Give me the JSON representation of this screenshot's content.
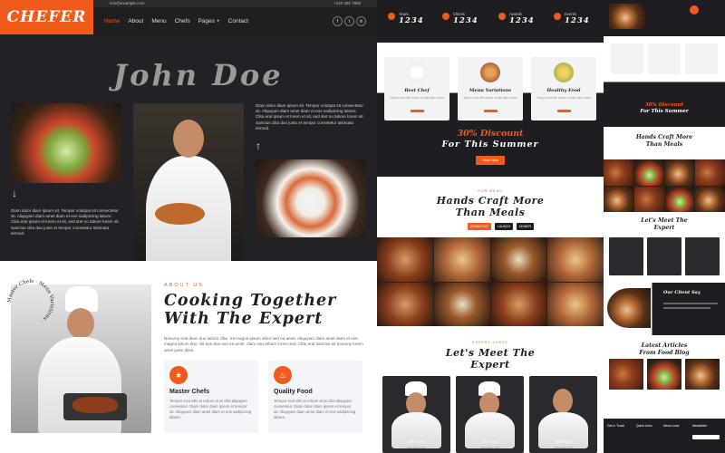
{
  "brand": "CHEFER",
  "topbar": {
    "email": "info@example.com",
    "phone": "+123 456 7890"
  },
  "nav": {
    "items": [
      "Home",
      "About",
      "Menu",
      "Chefs",
      "Pages +",
      "Contact"
    ]
  },
  "social": [
    "f",
    "t",
    "in"
  ],
  "hero": {
    "name": "John Doe",
    "para_right": "Diam dolor diam ipsum sit. Tempor volutpat sit consectetur sit. Aliquyam diam amet diam et eos sadipscing labore. Clita erat ipsum et lorem et sit, sed stet no labore lorem sit. Sanctus clita duo justo et tempor consetetur takimata eirmod.",
    "para_left": "Diam dolor diam ipsum sit. Tempor volutpat sit consectetur sit. Aliquyam diam amet diam et eos sadipscing labore. Clita erat ipsum et lorem et sit, sed stet no labore lorem sit. Sanctus clita duo justo et tempor consetetur takimata eirmod."
  },
  "about": {
    "eyebrow": "ABOUT US",
    "title": "Cooking Together With The Expert",
    "para": "Nonumy erat diam duo labore clita. Sit magna ipsum dolor sed ea amet. Aliquyam diam amet diam et eos magna ipsum duo. Sit eos duo sed ea amet. diam sea rebum lorem sed. Clita erat sanctus sit nonumy lorem amet justo diam.",
    "circle_text": "Master Chefs · Menu Variations ·",
    "features": [
      {
        "title": "Master Chefs",
        "text": "Tempor erat elitr at rebum at at clita aliquyam consetetur. Diam dolor diam ipsum et tempor sit. Aliquyam diam amet diam et eos sadipscing labore."
      },
      {
        "title": "Quality Food",
        "text": "Tempor erat elitr at rebum at at clita aliquyam consetetur. Diam dolor diam ipsum et tempor sit. Aliquyam diam amet diam et eos sadipscing labore."
      }
    ]
  },
  "stats": [
    {
      "label": "Years",
      "value": "1234"
    },
    {
      "label": "Clients",
      "value": "1234"
    },
    {
      "label": "Awards",
      "value": "1234"
    },
    {
      "label": "Events",
      "value": "1234"
    }
  ],
  "services": [
    {
      "title": "Best Chef",
      "text": "Tempor erat elitr rebum at clita diam lorem",
      "btn": "Read More"
    },
    {
      "title": "Menu Variations",
      "text": "Tempor erat elitr rebum at clita diam lorem",
      "btn": "Read More"
    },
    {
      "title": "Healthy Food",
      "text": "Tempor erat elitr rebum at clita diam lorem",
      "btn": "Read More"
    }
  ],
  "discount": {
    "line1": "30% Discount",
    "line2": "For This Summer",
    "button": "Order Now"
  },
  "menu": {
    "eyebrow": "OUR MENU",
    "title": "Hands Craft More Than Meals",
    "tabs": [
      "BREAKFAST",
      "LAUNCH",
      "DINNER"
    ]
  },
  "chefs": {
    "eyebrow": "EXPERT CHEFS",
    "title": "Let's Meet The Expert",
    "team": [
      {
        "name": "John Doe",
        "role": "Executive Chef"
      },
      {
        "name": "John Doe",
        "role": "Executive Chef"
      },
      {
        "name": "John Doe",
        "role": "Executive Chef"
      }
    ]
  },
  "right": {
    "discount1": "30% Discount",
    "discount2": "For This Summer",
    "menu_title": "Hands Craft More Than Meals",
    "chefs_title": "Let's Meet The Expert",
    "client_title": "Our Client Say",
    "blog_title": "Latest Articles From Food Blog",
    "footer": [
      "Get In Touch",
      "Quick Links",
      "Menu Links",
      "Newsletter"
    ]
  }
}
